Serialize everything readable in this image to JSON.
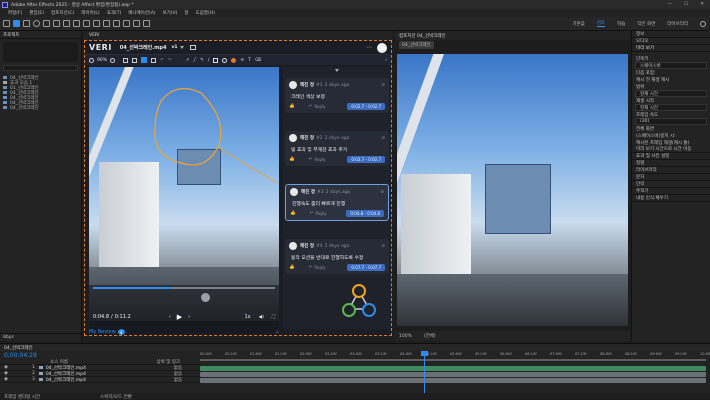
{
  "titlebar": {
    "title": "Adobe After Effects 2025 - 영상 Affect 편집(편집됨).aep *"
  },
  "menu": [
    "파일(F)",
    "편집(E)",
    "컴포지션(C)",
    "레이어(L)",
    "효과(T)",
    "애니메이션(A)",
    "보기(V)",
    "창",
    "도움말(H)"
  ],
  "workspaces": [
    "기본값",
    "검토",
    "학습",
    "작은 화면",
    "라이브러리"
  ],
  "project": {
    "panel_title": "프로젝트",
    "items": [
      {
        "name": "04_선박크레인",
        "color": "#6a8fbf"
      },
      {
        "name": "효과 모음 1",
        "color": "#a6a6a6"
      },
      {
        "name": "01_선박크레인",
        "color": "#6a8fbf"
      },
      {
        "name": "04_선박크레인",
        "color": "#6a8fbf"
      },
      {
        "name": "04_선박크레인",
        "color": "#6a8fbf"
      },
      {
        "name": "04_선박크레인",
        "color": "#6a8fbf"
      },
      {
        "name": "04_선박크레인",
        "color": "#6a8fbf"
      }
    ],
    "bottom": "8bpc"
  },
  "veri": {
    "tab": "VERI",
    "logo": "VERI",
    "filename": "04_선박크레인.mp4",
    "version": "v1",
    "zoom": "90%",
    "time_current": "0:04.8",
    "time_total": "0:11.2",
    "speed": "1x",
    "progress_pct": 0.43,
    "footer_link": "My Review",
    "footer_count": "4",
    "comments": [
      {
        "author": "해진 정",
        "num": "#1",
        "time": "2 days ago",
        "text": "크레인 색상 보정",
        "range": "0:02.7 - 0:02.7",
        "reply": "Reply",
        "active": false
      },
      {
        "author": "해진 정",
        "num": "#2",
        "time": "2 days ago",
        "text": "빛 효과 및 무게감 효과 추가",
        "range": "0:02.7 - 0:02.7",
        "reply": "Reply",
        "active": false
      },
      {
        "author": "해진 정",
        "num": "#3",
        "time": "2 days ago",
        "text": "진행속도 좀더 빠르게 진행",
        "range": "0:04.8 - 0:04.8",
        "reply": "Reply",
        "active": true
      },
      {
        "author": "해진 정",
        "num": "#4",
        "time": "2 days ago",
        "text": "동작 모션을 반대로 진행하도록 수정",
        "range": "0:07.7 - 0:07.7",
        "reply": "Reply",
        "active": false
      }
    ]
  },
  "comp": {
    "tab": "컴포지션 04_선박크레인",
    "crumb": "04_선박크레인",
    "zoom": "100%",
    "quality": "(전체)"
  },
  "right": {
    "items": [
      "정보",
      "오디오",
      "미리 보기",
      "단축키",
      "스페이스바",
      "다음 포함:",
      "캐시 전 재생 캐시",
      "범위",
      "현재 시간",
      "재생 시작",
      "현재 시간",
      "프레임 속도",
      "(30)",
      "전체 화면",
      "(스페이스바)중지 시:",
      "캐시된 프레임 재생(캐시 통)",
      "미리 보기 시간으로 시간 이동",
      "효과 및 사전 설정",
      "정렬",
      "라이브러리",
      "문자",
      "단락",
      "추적기",
      "내용 인식 채우기"
    ]
  },
  "timeline": {
    "tab": "04_선박크레인",
    "timecode": "0;00;04;29",
    "col_source": "소스 이름",
    "col_parent": "상위 및 링크",
    "layers": [
      {
        "num": "1",
        "name": "04_선박크레인.mp4",
        "parent": "없음"
      },
      {
        "num": "2",
        "name": "04_선박크레인.mp4",
        "parent": "없음"
      },
      {
        "num": "3",
        "name": "04_선박크레인.mp4",
        "parent": "없음"
      }
    ],
    "ruler": [
      "00:00f",
      "00:15f",
      "01:00f",
      "01:15f",
      "02:00f",
      "02:15f",
      "03:00f",
      "03:15f",
      "04:00f",
      "04:15f",
      "05:00f",
      "05:15f",
      "06:00f",
      "06:15f",
      "07:00f",
      "07:15f",
      "08:00f",
      "08:15f",
      "09:00f",
      "09:15f",
      "10:00f"
    ],
    "bottom_left": "프레임 렌더링 시간",
    "bottom_right": "스위치/모드 전환"
  },
  "colors": {
    "accent": "#2d8ceb",
    "orange": "#e07a2a",
    "veri_bg": "#1a1d24"
  }
}
